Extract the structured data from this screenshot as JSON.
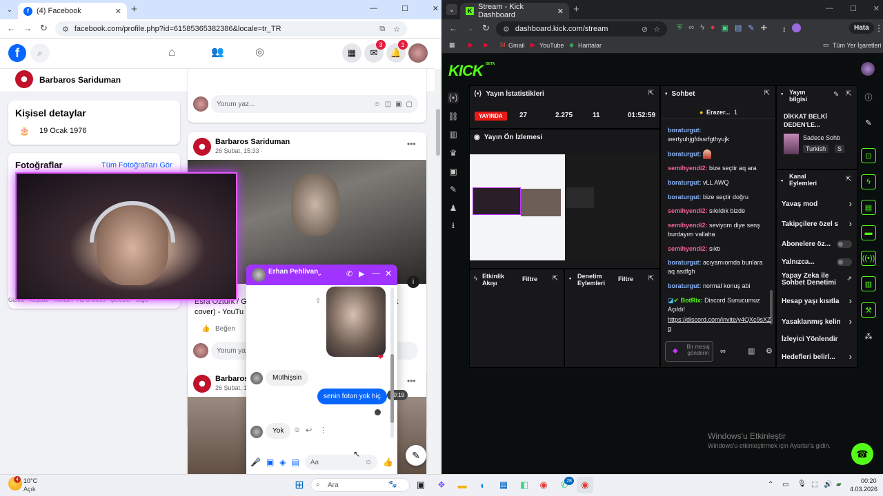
{
  "left_browser": {
    "tab_title": "(4) Facebook",
    "url": "facebook.com/profile.php?id=61585365382386&locale=tr_TR",
    "profile_initial": "G"
  },
  "facebook": {
    "badges": {
      "messenger": "3",
      "notifications": "1"
    },
    "profile_name": "Barbaros Sariduman",
    "details_title": "Kişisel detaylar",
    "birthday": "19 Ocak 1976",
    "photos_title": "Fotoğraflar",
    "all_photos": "Tüm Fotoğrafları Gör",
    "comment_placeholder": "Yorum yaz...",
    "post1": {
      "author": "Barbaros Sariduman",
      "date": "26 Şubat, 15:33 ·"
    },
    "post1_caption": "Esra Ozturk / G",
    "post1_caption2": "cover) - YouTu",
    "post1_caption_k": "k",
    "like_label": "Beğen",
    "post2": {
      "author": "Barbaros S",
      "date": "26 Şubat, 14"
    },
    "under_photo_text": "Gizlilik · Koşullar · Reklam · Ad Choices · Çerezler · Diğer"
  },
  "messenger": {
    "contact": "Erhan Pehlivan",
    "messages": [
      {
        "text": "Müthişsin",
        "from": "them"
      },
      {
        "text": "senin foton yok hiç",
        "from": "me",
        "time": "00:19"
      },
      {
        "text": "Yok",
        "from": "them"
      }
    ],
    "input_placeholder": "Aa"
  },
  "right_browser": {
    "tab_title": "Stream - Kick Dashboard",
    "url": "dashboard.kick.com/stream",
    "error_btn": "Hata",
    "bookmarks": [
      "Gmail",
      "YouTube",
      "Haritalar"
    ],
    "all_bookmarks": "Tüm Yer İşaretleri"
  },
  "kick": {
    "logo": "KICK",
    "beta": "BETA",
    "stats_title": "Yayın İstatistikleri",
    "live_badge": "YAYINDA",
    "stats": [
      "27",
      "2.275",
      "11",
      "01:52:59"
    ],
    "preview_title": "Yayın Ön İzlemesi",
    "activity_title": "Etkinlik Akışı",
    "moderation_title": "Denetim Eylemleri",
    "filter_label": "Filtre",
    "chat_title": "Sohbet",
    "chat_pinned_user": "Erazer...",
    "chat_pinned_count": "1",
    "chat": [
      {
        "user": "boraturgut:",
        "text": "wertyuhjgfdssrfgthyujk"
      },
      {
        "user": "boraturgut:",
        "text": ""
      },
      {
        "user": "semihyendi2:",
        "text": "bize seçtir aq ara"
      },
      {
        "user": "boraturgut:",
        "text": "vLL AWQ"
      },
      {
        "user": "boraturgut:",
        "text": "bize seçtir doğru"
      },
      {
        "user": "semihyendi2:",
        "text": "sıkıldık bizde"
      },
      {
        "user": "semihyendi2:",
        "text": "seviyom diye senş burdayım vallaha"
      },
      {
        "user": "semihyendi2:",
        "text": "sıktı"
      },
      {
        "user": "boraturgut:",
        "text": "acıyamıomda bunlara aq asdfgh"
      },
      {
        "user": "boraturgut:",
        "text": "normal konuş abi"
      }
    ],
    "bot_user": "BotRix:",
    "bot_text": "Discord Sunucumuz Açıldı!",
    "bot_link": "https://discord.com/invite/y4QXc9sXZq",
    "chat_input": "Bir mesaj gönderin",
    "info_title": "Yayın bilgisi",
    "info_stream_title": "DİKKAT BELKİ DEDEN'LE...",
    "info_category": "Sadece Sohb",
    "info_tags": [
      "Turkish",
      "S"
    ],
    "channel_actions_title": "Kanal Eylemleri",
    "actions": [
      {
        "label": "Yavaş mod",
        "type": "chevron"
      },
      {
        "label": "Takipçilere özel s",
        "type": "chevron"
      },
      {
        "label": "Abonelere öz...",
        "type": "toggle"
      },
      {
        "label": "Yalnızca...",
        "type": "toggle"
      },
      {
        "label": "Yapay Zeka ile Sohbet Denetimi",
        "type": "ext"
      },
      {
        "label": "Hesap yaşı kısıtla",
        "type": "chevron"
      },
      {
        "label": "Yasaklanmış kelin",
        "type": "chevron"
      },
      {
        "label": "İzleyici Yönlendir",
        "type": "none"
      },
      {
        "label": "Hedefleri belirl...",
        "type": "chevron"
      }
    ]
  },
  "windows_activation": {
    "title": "Windows'u Etkinleştir",
    "subtitle": "Windows'u etkinleştirmek için Ayarlar'a gidin."
  },
  "taskbar": {
    "weather_temp": "10°C",
    "weather_desc": "Açık",
    "weather_badge": "4",
    "search_placeholder": "Ara",
    "whatsapp_badge": "28",
    "time": "00:20",
    "date": "4.03.2026"
  },
  "colors": {
    "kick_green": "#53fc18",
    "fb_blue": "#0866ff",
    "live_red": "#e91916",
    "messenger_purple": "#a033ff"
  }
}
